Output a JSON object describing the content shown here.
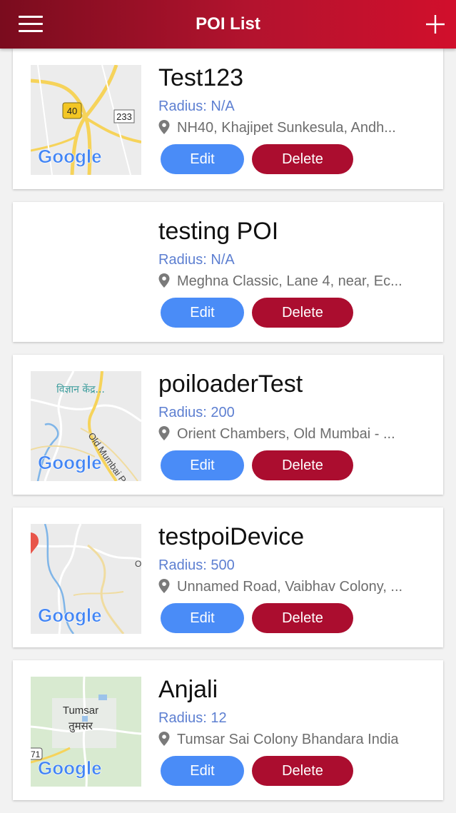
{
  "header": {
    "title": "POI List",
    "menu_icon": "hamburger-menu-icon",
    "add_icon": "plus-icon"
  },
  "colors": {
    "header_start": "#7a0c1e",
    "header_end": "#d10f2c",
    "edit": "#4a8cf7",
    "delete": "#ab0d2f",
    "radius_text": "#5d7fd1"
  },
  "buttons": {
    "edit_label": "Edit",
    "delete_label": "Delete"
  },
  "pois": [
    {
      "name": "Test123",
      "radius": "Radius: N/A",
      "address": "NH40, Khajipet Sunkesula, Andh...",
      "map": {
        "shield": "40",
        "road_label": "233",
        "logo": "Google"
      }
    },
    {
      "name": "testing POI",
      "radius": "Radius: N/A",
      "address": "Meghna Classic, Lane 4, near, Ec..."
    },
    {
      "name": "poiloaderTest",
      "radius": "Radius: 200",
      "address": "Orient Chambers, Old Mumbai - ...",
      "map": {
        "place_label": "विज्ञान केंद्र...",
        "road_label": "Old Mumbai P",
        "logo": "Google"
      }
    },
    {
      "name": "testpoiDevice",
      "radius": "Radius: 500",
      "address": "Unnamed Road, Vaibhav Colony, ...",
      "map": {
        "logo": "Google"
      }
    },
    {
      "name": "Anjali",
      "radius": "Radius: 12",
      "address": "Tumsar Sai Colony Bhandara India",
      "map": {
        "place_label": "Tumsar",
        "place_label_2": "तुमसर",
        "road_label": "71",
        "logo": "Google"
      }
    }
  ]
}
